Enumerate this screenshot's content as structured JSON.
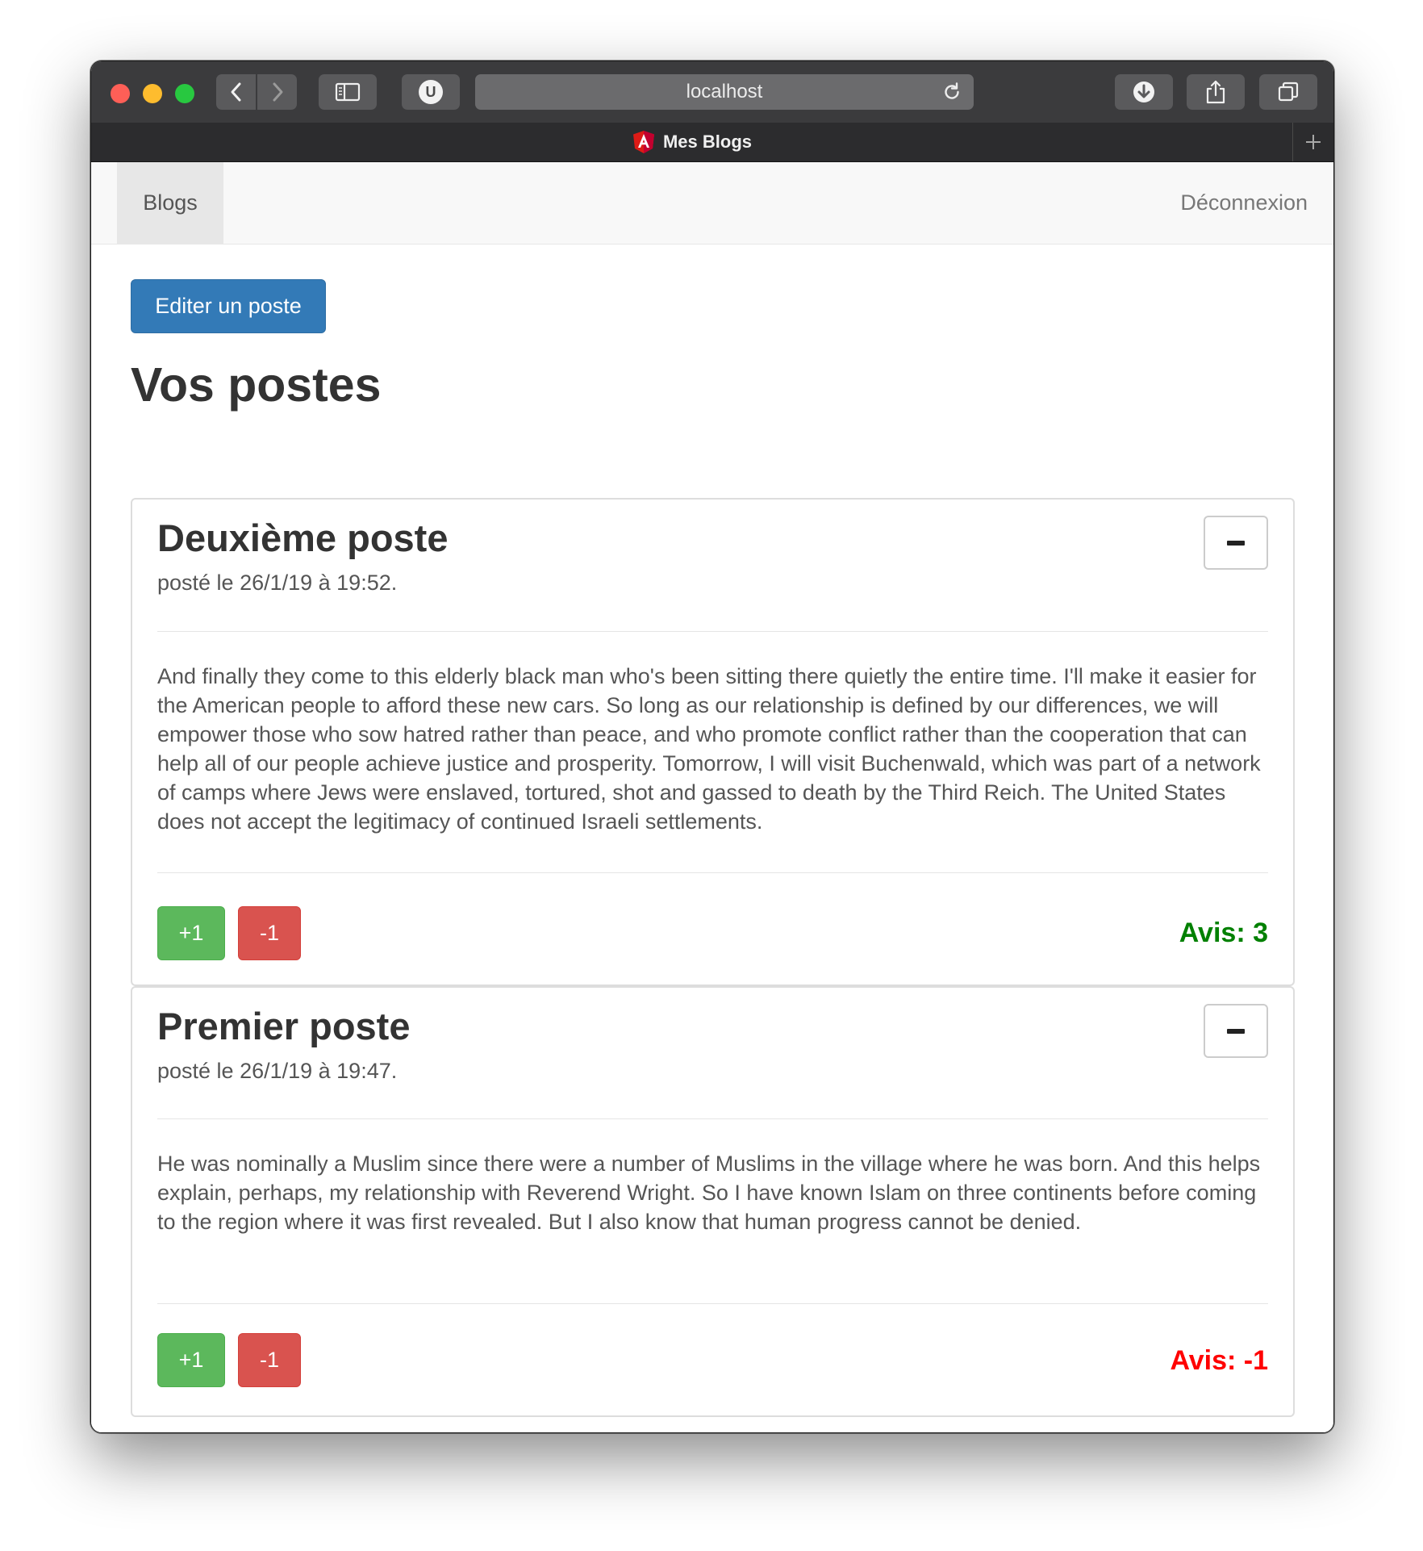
{
  "browser": {
    "address": "localhost",
    "tab_title": "Mes Blogs",
    "extension_badge": "U"
  },
  "navbar": {
    "brand_link": "Blogs",
    "logout_link": "Déconnexion"
  },
  "actions": {
    "edit_label": "Editer un poste"
  },
  "page": {
    "title": "Vos postes"
  },
  "posts": [
    {
      "title": "Deuxième poste",
      "date": "posté le 26/1/19 à 19:52.",
      "body": "And finally they come to this elderly black man who's been sitting there quietly the entire time. I'll make it easier for the American people to afford these new cars. So long as our relationship is defined by our differences, we will empower those who sow hatred rather than peace, and who promote conflict rather than the cooperation that can help all of our people achieve justice and prosperity. Tomorrow, I will visit Buchenwald, which was part of a network of camps where Jews were enslaved, tortured, shot and gassed to death by the Third Reich. The United States does not accept the legitimacy of continued Israeli settlements.",
      "upvote_label": "+1",
      "downvote_label": "-1",
      "avis": "Avis: 3",
      "avis_color": "#008000"
    },
    {
      "title": "Premier poste",
      "date": "posté le 26/1/19 à 19:47.",
      "body": "He was nominally a Muslim since there were a number of Muslims in the village where he was born. And this helps explain, perhaps, my relationship with Reverend Wright. So I have known Islam on three continents before coming to the region where it was first revealed. But I also know that human progress cannot be denied.",
      "upvote_label": "+1",
      "downvote_label": "-1",
      "avis": "Avis: -1",
      "avis_color": "#ff0000"
    }
  ],
  "icons": {
    "back": "chevron-left-icon",
    "forward": "chevron-right-icon",
    "sidebar": "sidebar-icon",
    "reload": "reload-icon",
    "download": "download-icon",
    "share": "share-icon",
    "tabs": "tabs-overview-icon",
    "favicon": "angular-logo-icon",
    "new_tab": "plus-icon",
    "delete": "minus-icon"
  },
  "colors": {
    "primary": "#337ab7",
    "success": "#5cb85c",
    "danger": "#d9534f"
  }
}
